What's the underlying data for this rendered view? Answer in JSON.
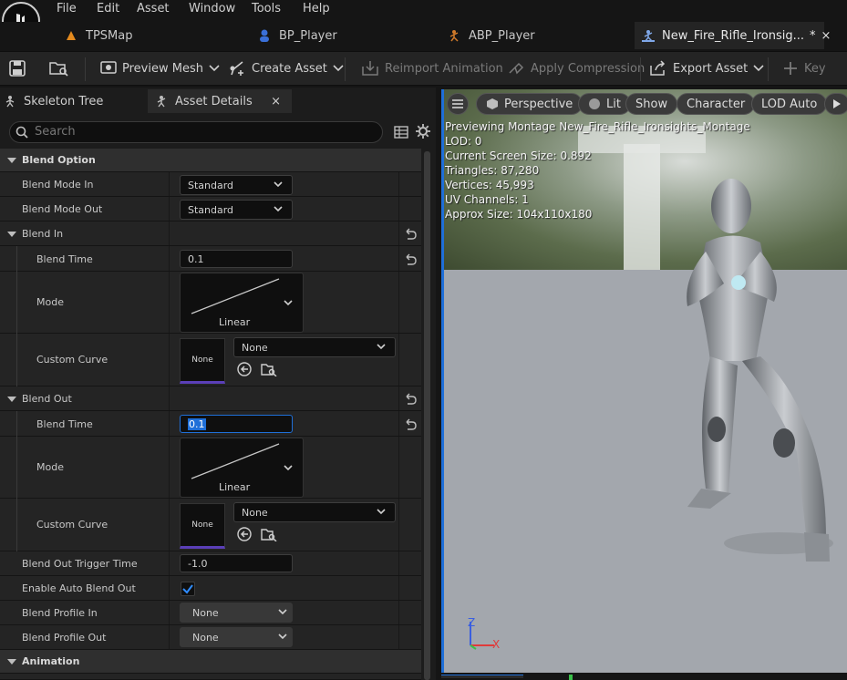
{
  "menu": {
    "file": "File",
    "edit": "Edit",
    "asset": "Asset",
    "window": "Window",
    "tools": "Tools",
    "help": "Help"
  },
  "tabs": [
    {
      "label": "TPSMap"
    },
    {
      "label": "BP_Player"
    },
    {
      "label": "ABP_Player"
    },
    {
      "label": "New_Fire_Rifle_Ironsig...",
      "marker": "*",
      "close": "×"
    }
  ],
  "toolbar": {
    "preview_mesh": "Preview Mesh",
    "create_asset": "Create Asset",
    "reimport": "Reimport Animation",
    "apply_compression": "Apply Compression",
    "export_asset": "Export Asset",
    "key": "Key"
  },
  "panel_tabs": {
    "skeleton_tree": "Skeleton Tree",
    "asset_details": "Asset Details",
    "close": "×"
  },
  "search": {
    "placeholder": "Search"
  },
  "details": {
    "blend_option": "Blend Option",
    "blend_mode_in": {
      "label": "Blend Mode In",
      "value": "Standard"
    },
    "blend_mode_out": {
      "label": "Blend Mode Out",
      "value": "Standard"
    },
    "blend_in": {
      "label": "Blend In",
      "blend_time": {
        "label": "Blend Time",
        "value": "0.1"
      },
      "mode": {
        "label": "Mode",
        "value": "Linear"
      },
      "custom_curve": {
        "label": "Custom Curve",
        "thumb": "None",
        "value": "None"
      }
    },
    "blend_out": {
      "label": "Blend Out",
      "blend_time": {
        "label": "Blend Time",
        "value": "0.1"
      },
      "mode": {
        "label": "Mode",
        "value": "Linear"
      },
      "custom_curve": {
        "label": "Custom Curve",
        "thumb": "None",
        "value": "None"
      }
    },
    "blend_out_trigger": {
      "label": "Blend Out Trigger Time",
      "value": "-1.0"
    },
    "auto_blend_out": {
      "label": "Enable Auto Blend Out",
      "checked": true
    },
    "profile_in": {
      "label": "Blend Profile In",
      "value": "None"
    },
    "profile_out": {
      "label": "Blend Profile Out",
      "value": "None"
    },
    "animation": "Animation"
  },
  "viewport": {
    "perspective": "Perspective",
    "lit": "Lit",
    "show": "Show",
    "character": "Character",
    "lod": "LOD Auto",
    "stats": [
      "Previewing Montage New_Fire_Rifle_Ironsights_Montage",
      "LOD: 0",
      "Current Screen Size: 0.892",
      "Triangles: 87,280",
      "Vertices: 45,993",
      "UV Channels: 1",
      "Approx Size: 104x110x180"
    ],
    "axis_z": "Z",
    "axis_x": "X"
  },
  "colors": {
    "accent": "#1f6fd8",
    "check": "#2f8cff",
    "curve_underline": "#5b3fb8"
  }
}
